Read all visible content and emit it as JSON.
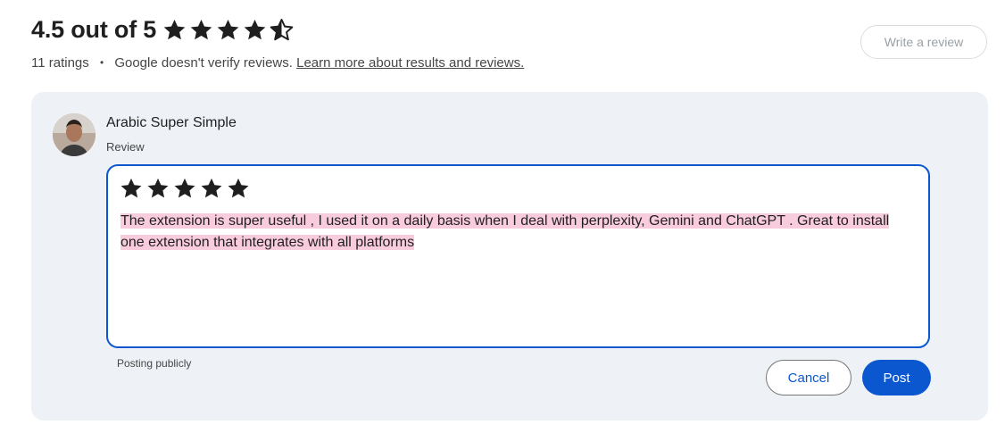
{
  "summary": {
    "title": "4.5 out of 5",
    "rating_value": 4.5,
    "ratings_count_text": "11 ratings",
    "separator": "•",
    "verify_text": "Google doesn't verify reviews.",
    "learn_more_link": "Learn more about results and reviews."
  },
  "write_review_button": "Write a review",
  "review_form": {
    "reviewer_name": "Arabic Super Simple",
    "field_label": "Review",
    "selected_stars": 5,
    "review_text": "The extension is super useful , I used it on a daily basis when I deal with perplexity, Gemini and ChatGPT . Great to install one extension that integrates with all platforms",
    "posting_note": "Posting publicly",
    "cancel_label": "Cancel",
    "post_label": "Post"
  },
  "colors": {
    "accent": "#0b57d0",
    "panel_bg": "#eef2f7",
    "highlight": "#f9ccdd"
  },
  "icons": [
    "star-icon",
    "half-star-icon",
    "avatar"
  ]
}
